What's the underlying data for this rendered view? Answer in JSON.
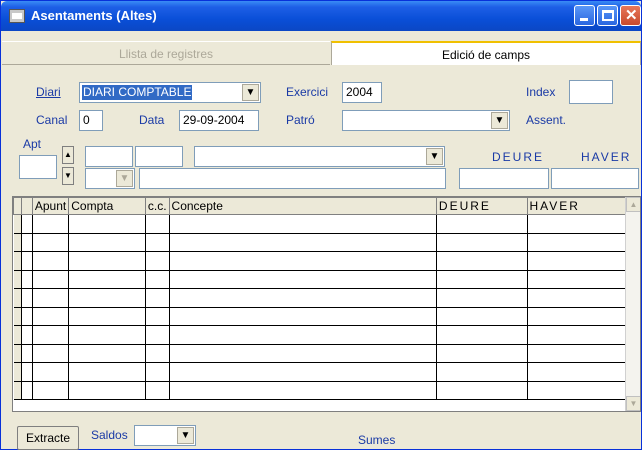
{
  "window": {
    "title": "Asentaments (Altes)"
  },
  "tabs": [
    {
      "label": "Llista de registres"
    },
    {
      "label": "Edició de camps"
    }
  ],
  "form": {
    "diari_label": "Diari",
    "diari_value": "DIARI COMPTABLE",
    "exercici_label": "Exercici",
    "exercici_value": "2004",
    "index_label": "Index",
    "index_value": "",
    "canal_label": "Canal",
    "canal_value": "0",
    "data_label": "Data",
    "data_value": "29-09-2004",
    "patro_label": "Patró",
    "patro_value": "",
    "assent_label": "Assent.",
    "apt_label": "Apt",
    "deure_label": "DEURE",
    "haver_label": "HAVER"
  },
  "grid": {
    "columns": [
      "Apunt",
      "Compta",
      "c.c.",
      "Concepte",
      "DEURE",
      "HAVER"
    ],
    "rows": [
      [
        "",
        "",
        "",
        "",
        "",
        ""
      ],
      [
        "",
        "",
        "",
        "",
        "",
        ""
      ],
      [
        "",
        "",
        "",
        "",
        "",
        ""
      ],
      [
        "",
        "",
        "",
        "",
        "",
        ""
      ],
      [
        "",
        "",
        "",
        "",
        "",
        ""
      ],
      [
        "",
        "",
        "",
        "",
        "",
        ""
      ],
      [
        "",
        "",
        "",
        "",
        "",
        ""
      ],
      [
        "",
        "",
        "",
        "",
        "",
        ""
      ],
      [
        "",
        "",
        "",
        "",
        "",
        ""
      ],
      [
        "",
        "",
        "",
        "",
        "",
        ""
      ]
    ]
  },
  "footer": {
    "extracte_label": "Extracte",
    "saldos_label": "Saldos",
    "saldos_value": "",
    "sumes_label": "Sumes"
  },
  "icons": {
    "app": "window-app-icon",
    "dropdown": "chevron-down-icon",
    "spin_up": "arrow-up-icon",
    "spin_down": "arrow-down-icon"
  },
  "colors": {
    "title_bar": "#0a4fd8",
    "label_blue": "#1a3aa6",
    "selection": "#316ac5",
    "tab_highlight": "#f0c000"
  }
}
